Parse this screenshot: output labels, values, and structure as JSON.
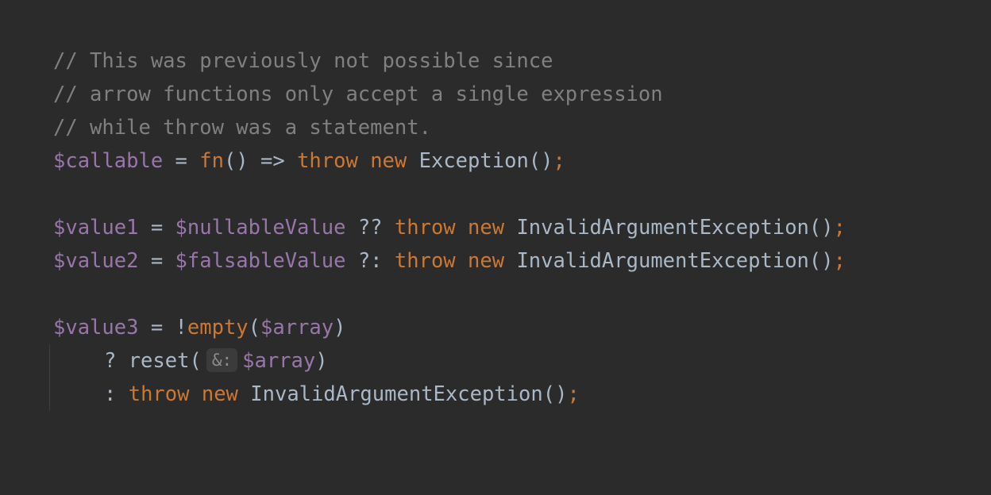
{
  "code": {
    "line1": {
      "comment": "// This was previously not possible since"
    },
    "line2": {
      "comment": "// arrow functions only accept a single expression"
    },
    "line3": {
      "comment": "// while throw was a statement."
    },
    "line4": {
      "var": "$callable",
      "assign": " = ",
      "fn": "fn",
      "parens": "() => ",
      "throw": "throw",
      "new": "new",
      "class": "Exception()",
      "semi": ";"
    },
    "line6": {
      "var": "$value1",
      "assign": " = ",
      "var2": "$nullableValue",
      "op": " ?? ",
      "throw": "throw",
      "new": "new",
      "class": "InvalidArgumentException()",
      "semi": ";"
    },
    "line7": {
      "var": "$value2",
      "assign": " = ",
      "var2": "$falsableValue",
      "op": " ?: ",
      "throw": "throw",
      "new": "new",
      "class": "InvalidArgumentException()",
      "semi": ";"
    },
    "line9": {
      "var": "$value3",
      "assign": " = !",
      "fn": "empty",
      "open": "(",
      "arg": "$array",
      "close": ")"
    },
    "line10": {
      "prefix": "? reset(",
      "hint": "&:",
      "arg": "$array",
      "close": ")"
    },
    "line11": {
      "prefix": ": ",
      "throw": "throw",
      "new": "new",
      "class": "InvalidArgumentException()",
      "semi": ";"
    }
  },
  "colors": {
    "background": "#2b2b2b",
    "comment": "#808080",
    "variable": "#9876aa",
    "keyword": "#cc7832",
    "plain": "#a9b7c6"
  }
}
